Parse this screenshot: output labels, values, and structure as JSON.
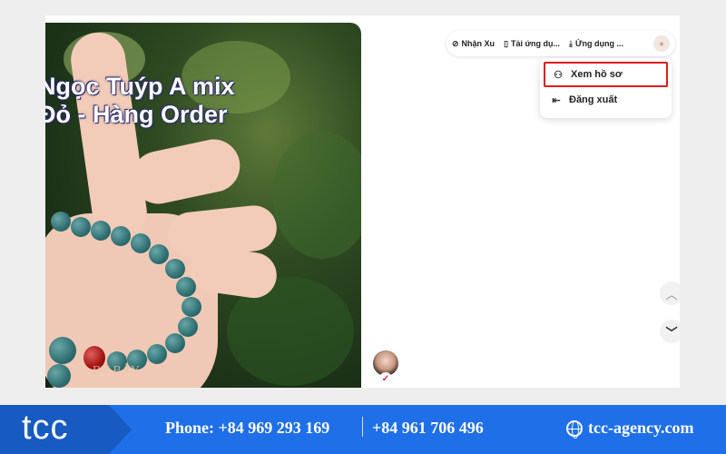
{
  "video": {
    "caption_line1": "Ngọc Tuýp A mix",
    "caption_line2": "Đỏ - Hàng Order",
    "watermark": "BY BẢY"
  },
  "topbar": {
    "items": [
      {
        "icon": "coin-icon",
        "glyph": "⊘",
        "label": "Nhận Xu"
      },
      {
        "icon": "phone-icon",
        "glyph": "▯",
        "label": "Tải ứng dụ..."
      },
      {
        "icon": "download-icon",
        "glyph": "⤓",
        "label": "Ứng dụng ..."
      }
    ]
  },
  "menu": {
    "items": [
      {
        "icon": "user-icon",
        "glyph": "⚇",
        "label": "Xem hồ sơ"
      },
      {
        "icon": "logout-icon",
        "glyph": "⇤",
        "label": "Đăng xuất"
      }
    ]
  },
  "nav": {
    "up_glyph": "︿",
    "down_glyph": "﹀"
  },
  "footer": {
    "logo": "tcc",
    "phone1": "Phone: +84 969 293 169",
    "phone2": "+84 961 706 496",
    "website": "tcc-agency.com"
  },
  "colors": {
    "accent_blue": "#1f6fe8",
    "highlight_red": "#e01c1c"
  }
}
